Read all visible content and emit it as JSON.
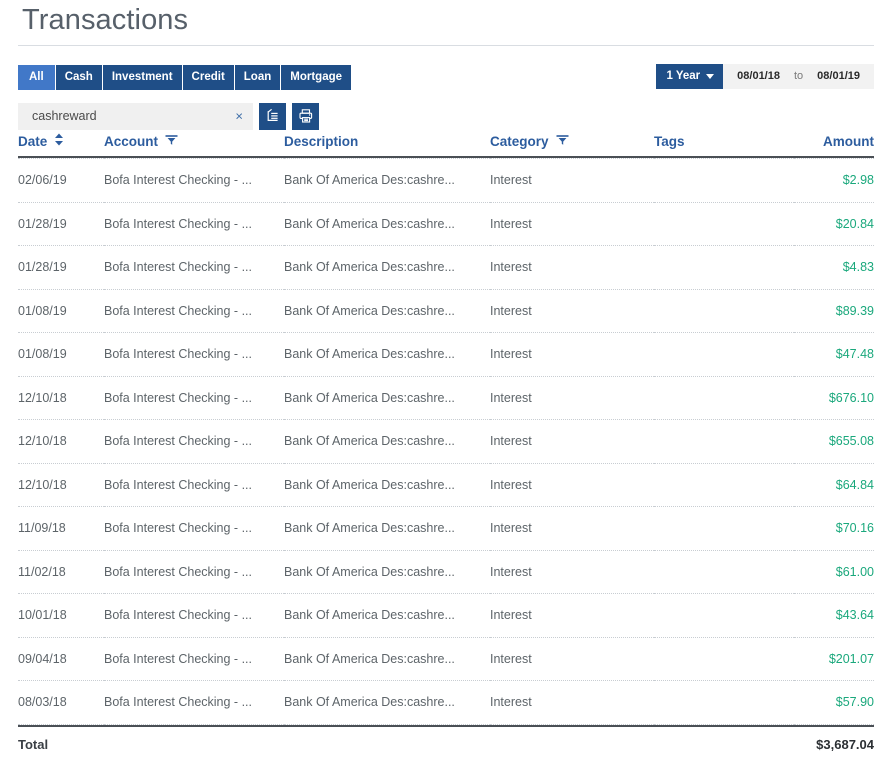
{
  "page": {
    "title": "Transactions"
  },
  "filters": {
    "type_tabs": [
      {
        "label": "All",
        "active": true
      },
      {
        "label": "Cash",
        "active": false
      },
      {
        "label": "Investment",
        "active": false
      },
      {
        "label": "Credit",
        "active": false
      },
      {
        "label": "Loan",
        "active": false
      },
      {
        "label": "Mortgage",
        "active": false
      }
    ],
    "date_range": {
      "preset": "1 Year",
      "start": "08/01/18",
      "separator": "to",
      "end": "08/01/19"
    },
    "search": {
      "value": "cashreward",
      "placeholder": "",
      "clear_label": "×"
    },
    "actions": [
      {
        "icon": "edit-list-icon",
        "label": "Edit transactions"
      },
      {
        "icon": "printer-icon",
        "label": "Print transactions"
      }
    ]
  },
  "table": {
    "columns": [
      {
        "key": "date",
        "label": "Date",
        "icon": "sort-icon"
      },
      {
        "key": "account",
        "label": "Account",
        "icon": "filter-icon"
      },
      {
        "key": "description",
        "label": "Description",
        "icon": ""
      },
      {
        "key": "category",
        "label": "Category",
        "icon": "filter-icon"
      },
      {
        "key": "tags",
        "label": "Tags",
        "icon": ""
      },
      {
        "key": "amount",
        "label": "Amount",
        "icon": ""
      }
    ],
    "rows": [
      {
        "date": "02/06/19",
        "account": "Bofa Interest Checking - ...",
        "description": "Bank Of America Des:cashre...",
        "category": "Interest",
        "tags": "",
        "amount": "$2.98"
      },
      {
        "date": "01/28/19",
        "account": "Bofa Interest Checking - ...",
        "description": "Bank Of America Des:cashre...",
        "category": "Interest",
        "tags": "",
        "amount": "$20.84"
      },
      {
        "date": "01/28/19",
        "account": "Bofa Interest Checking - ...",
        "description": "Bank Of America Des:cashre...",
        "category": "Interest",
        "tags": "",
        "amount": "$4.83"
      },
      {
        "date": "01/08/19",
        "account": "Bofa Interest Checking - ...",
        "description": "Bank Of America Des:cashre...",
        "category": "Interest",
        "tags": "",
        "amount": "$89.39"
      },
      {
        "date": "01/08/19",
        "account": "Bofa Interest Checking - ...",
        "description": "Bank Of America Des:cashre...",
        "category": "Interest",
        "tags": "",
        "amount": "$47.48"
      },
      {
        "date": "12/10/18",
        "account": "Bofa Interest Checking - ...",
        "description": "Bank Of America Des:cashre...",
        "category": "Interest",
        "tags": "",
        "amount": "$676.10"
      },
      {
        "date": "12/10/18",
        "account": "Bofa Interest Checking - ...",
        "description": "Bank Of America Des:cashre...",
        "category": "Interest",
        "tags": "",
        "amount": "$655.08"
      },
      {
        "date": "12/10/18",
        "account": "Bofa Interest Checking - ...",
        "description": "Bank Of America Des:cashre...",
        "category": "Interest",
        "tags": "",
        "amount": "$64.84"
      },
      {
        "date": "11/09/18",
        "account": "Bofa Interest Checking - ...",
        "description": "Bank Of America Des:cashre...",
        "category": "Interest",
        "tags": "",
        "amount": "$70.16"
      },
      {
        "date": "11/02/18",
        "account": "Bofa Interest Checking - ...",
        "description": "Bank Of America Des:cashre...",
        "category": "Interest",
        "tags": "",
        "amount": "$61.00"
      },
      {
        "date": "10/01/18",
        "account": "Bofa Interest Checking - ...",
        "description": "Bank Of America Des:cashre...",
        "category": "Interest",
        "tags": "",
        "amount": "$43.64"
      },
      {
        "date": "09/04/18",
        "account": "Bofa Interest Checking - ...",
        "description": "Bank Of America Des:cashre...",
        "category": "Interest",
        "tags": "",
        "amount": "$201.07"
      },
      {
        "date": "08/03/18",
        "account": "Bofa Interest Checking - ...",
        "description": "Bank Of America Des:cashre...",
        "category": "Interest",
        "tags": "",
        "amount": "$57.90"
      }
    ],
    "footer": {
      "label": "Total",
      "amount": "$3,687.04"
    }
  },
  "colors": {
    "tab_blue": "#1f4e87",
    "tab_active_blue": "#4178c8",
    "header_blue": "#2c5c9e",
    "amount_green": "#1aa87c",
    "title_gray": "#57606a"
  }
}
